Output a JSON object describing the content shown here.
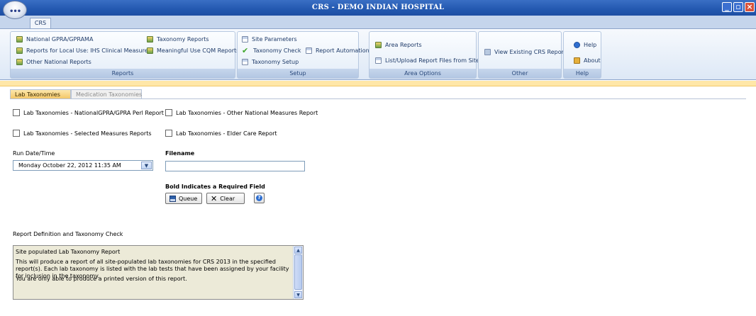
{
  "window": {
    "title": "CRS - DEMO INDIAN HOSPITAL",
    "orb_label": "•••"
  },
  "ribbon": {
    "tab": "CRS",
    "groups": {
      "reports": {
        "label": "Reports",
        "items": [
          "National GPRA/GPRAMA",
          "Reports for Local Use: IHS Clinical Measures",
          "Other National Reports",
          "Taxonomy Reports",
          "Meaningful Use CQM Reports"
        ]
      },
      "setup": {
        "label": "Setup",
        "items": [
          "Site Parameters",
          "Taxonomy Check",
          "Taxonomy Setup",
          "Report Automation"
        ]
      },
      "area": {
        "label": "Area Options",
        "items": [
          "Area Reports",
          "List/Upload Report Files from Site"
        ]
      },
      "other": {
        "label": "Other",
        "items": [
          "View Existing CRS Reports"
        ]
      },
      "help": {
        "label": "Help",
        "items": [
          "Help",
          "About"
        ]
      }
    }
  },
  "tabs": {
    "lab": "Lab Taxonomies",
    "medication": "Medication Taxonomies"
  },
  "checkboxes": {
    "gpra_perl": {
      "label": "Lab Taxonomies - NationalGPRA/GPRA Perl Report",
      "checked": false
    },
    "other_national": {
      "label": "Lab Taxonomies - Other National Measures Report",
      "checked": false
    },
    "selected_measures": {
      "label": "Lab Taxonomies - Selected Measures Reports",
      "checked": false
    },
    "elder_care": {
      "label": "Lab Taxonomies - Elder Care Report",
      "checked": false
    }
  },
  "run_datetime": {
    "label": "Run Date/Time",
    "value": "Monday    October  22, 2012  11:35 AM"
  },
  "filename": {
    "label": "Filename",
    "value": ""
  },
  "required_note": "Bold Indicates a Required Field",
  "buttons": {
    "queue": "Queue",
    "clear": "Clear"
  },
  "definition": {
    "label": "Report Definition and Taxonomy Check",
    "lines": [
      "Site populated Lab Taxonomy Report",
      "This will produce a report of all site-populated lab taxonomies for CRS 2013 in the specified report(s).  Each lab taxonomy is listed with the lab tests that have been assigned by your facility for inclusion in the taxonomy.",
      "You are only able to produce a printed version of this report."
    ]
  },
  "colors": {
    "titlebar": "#2358b0",
    "active_tab": "#f3c463",
    "definition_bg": "#ecead8"
  }
}
